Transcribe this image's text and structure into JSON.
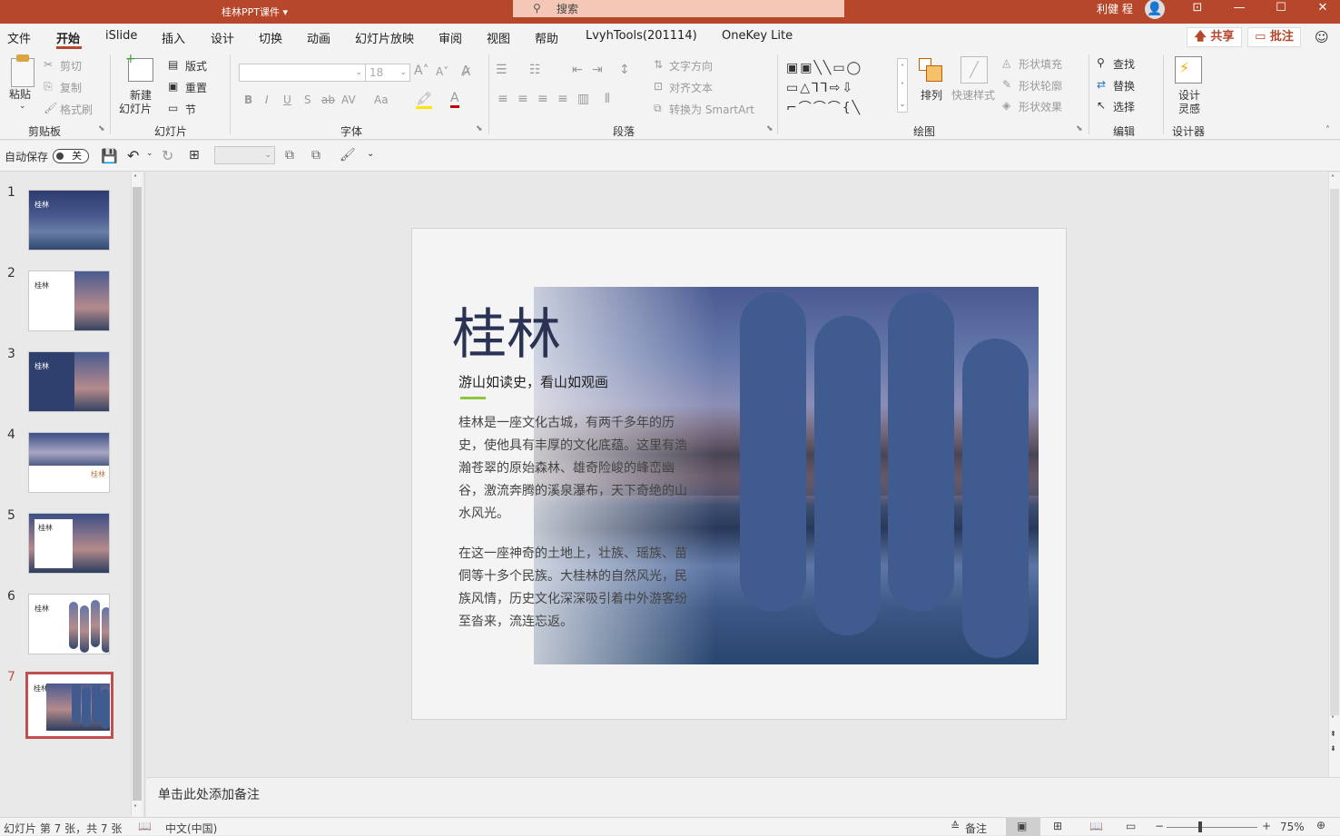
{
  "window": {
    "title": "桂林PPT课件 ▾",
    "search_placeholder": "搜索",
    "user": "利健 程",
    "buttons": {
      "ribbon_display": "⊡",
      "minimize": "—",
      "maximize": "☐",
      "close": "✕"
    }
  },
  "menu": {
    "tabs": [
      "文件",
      "开始",
      "iSlide",
      "插入",
      "设计",
      "切换",
      "动画",
      "幻灯片放映",
      "审阅",
      "视图",
      "帮助",
      "LvyhTools(201114)",
      "OneKey Lite"
    ],
    "active": "开始",
    "share": "🡅 共享",
    "comment": "▭ 批注"
  },
  "ribbon": {
    "clipboard": {
      "paste": "粘贴",
      "cut": "剪切",
      "copy": "复制",
      "format_painter": "格式刷",
      "group": "剪贴板"
    },
    "slides": {
      "new_slide": "新建",
      "new_slide2": "幻灯片",
      "layout": "版式",
      "reset": "重置",
      "section": "节",
      "group": "幻灯片"
    },
    "font": {
      "font_size": "18",
      "bold": "B",
      "italic": "I",
      "underline": "U",
      "shadow": "S",
      "strike": "ab",
      "spacing": "AV",
      "case": "Aa",
      "group": "字体"
    },
    "paragraph": {
      "text_direction": "文字方向",
      "align_text": "对齐文本",
      "smartart": "转换为 SmartArt",
      "group": "段落"
    },
    "drawing": {
      "arrange": "排列",
      "quick_styles": "快速样式",
      "fill": "形状填充",
      "outline": "形状轮廓",
      "effects": "形状效果",
      "group": "绘图"
    },
    "editing": {
      "find": "查找",
      "replace": "替换",
      "select": "选择",
      "group": "编辑"
    },
    "designer": {
      "ideas": "设计",
      "ideas2": "灵感",
      "group": "设计器"
    }
  },
  "qat": {
    "autosave": "自动保存",
    "toggle": "关"
  },
  "thumbnails": [
    {
      "num": "1",
      "title": "桂林"
    },
    {
      "num": "2",
      "title": "桂林"
    },
    {
      "num": "3",
      "title": "桂林"
    },
    {
      "num": "4",
      "title": "桂林"
    },
    {
      "num": "5",
      "title": "桂林"
    },
    {
      "num": "6",
      "title": "桂林"
    },
    {
      "num": "7",
      "title": "桂林"
    }
  ],
  "slide": {
    "title": "桂林",
    "subtitle": "游山如读史，看山如观画",
    "para1": "桂林是一座文化古城，有两千多年的历史，使他具有丰厚的文化底蕴。这里有浩瀚苍翠的原始森林、雄奇险峻的峰峦幽谷，激流奔腾的溪泉瀑布，天下奇绝的山水风光。",
    "para2": "在这一座神奇的土地上，壮族、瑶族、苗侗等十多个民族。大桂林的自然风光，民族风情，历史文化深深吸引着中外游客纷至沓来，流连忘返。",
    "accent_color": "#8dc63f",
    "pill_color": "#3f5b90"
  },
  "notes_placeholder": "单击此处添加备注",
  "status": {
    "slide_info": "幻灯片 第 7 张，共 7 张",
    "language": "中文(中国)",
    "notes_btn": "备注",
    "zoom": "75%"
  }
}
